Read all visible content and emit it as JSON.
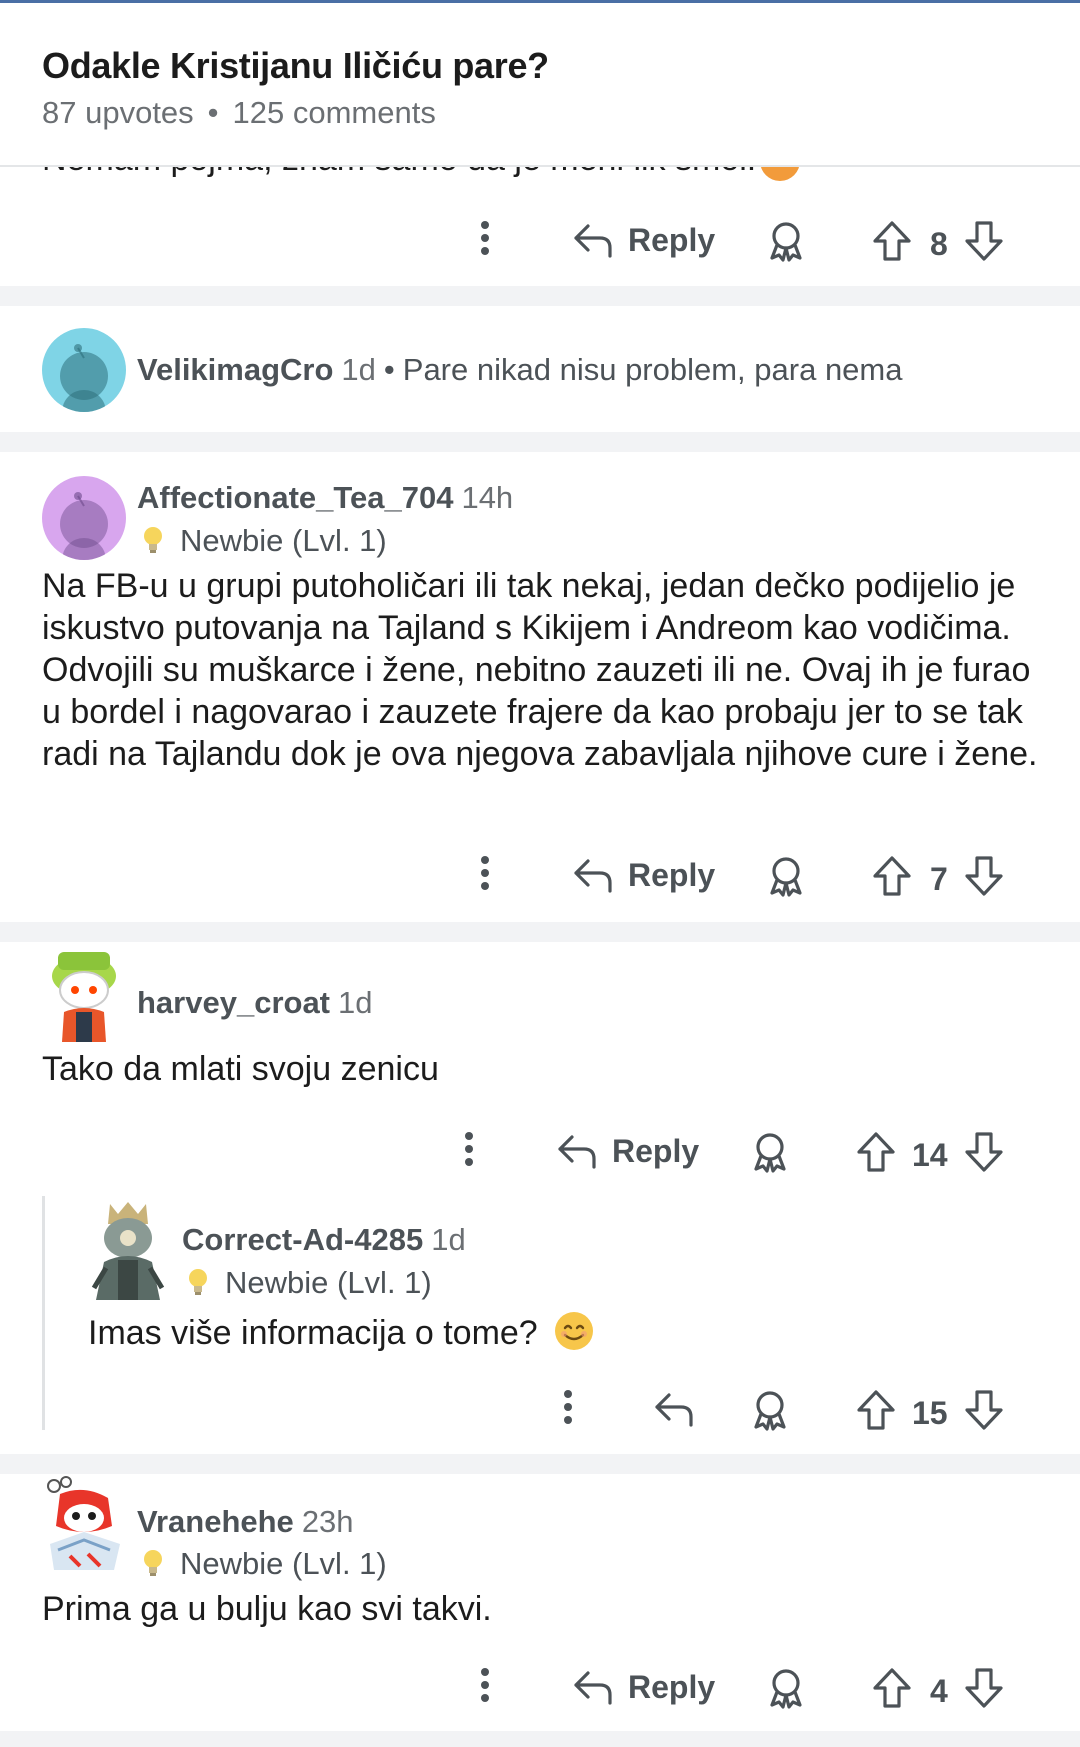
{
  "post": {
    "title": "Odakle Kristijanu Iličiću pare?",
    "upvotes": "87 upvotes",
    "separator": "•",
    "comments": "125 comments"
  },
  "partial_comment": {
    "text_fragment": "Nemam pojma, znam samo da je meni lik smol.",
    "reply_label": "Reply",
    "score": "8"
  },
  "collapsed_comment": {
    "author": "VelikimagCro",
    "time": "1d",
    "separator": "•",
    "text": "Pare nikad nisu problem, para nema"
  },
  "comments": [
    {
      "author": "Affectionate_Tea_704",
      "time": "14h",
      "flair": "Newbie (Lvl. 1)",
      "body": "Na FB-u u grupi putoholičari ili tak nekaj, jedan dečko podijelio je iskustvo putovanja na Tajland s Kikijem i Andreom kao vodičima. Odvojili su muškarce i žene, nebitno zauzeti ili ne. Ovaj ih je furao u bordel i nagovarao i zauzete frajere da kao probaju jer to se tak radi na Tajlandu dok je ova njegova zabavljala njihove cure i žene.",
      "reply_label": "Reply",
      "score": "7"
    },
    {
      "author": "harvey_croat",
      "time": "1d",
      "body": "Tako da mlati svoju zenicu",
      "reply_label": "Reply",
      "score": "14"
    },
    {
      "author": "Correct-Ad-4285",
      "time": "1d",
      "flair": "Newbie (Lvl. 1)",
      "body": "Imas više informacija o tome?",
      "score": "15"
    },
    {
      "author": "Vranehehe",
      "time": "23h",
      "flair": "Newbie (Lvl. 1)",
      "body": "Prima ga u bulju kao svi takvi.",
      "reply_label": "Reply",
      "score": "4"
    }
  ],
  "colors": {
    "accent_line": "#4a6fa5",
    "text_primary": "#1c1c1c",
    "text_muted": "#4c5257",
    "separator_bg": "#f2f3f5"
  }
}
